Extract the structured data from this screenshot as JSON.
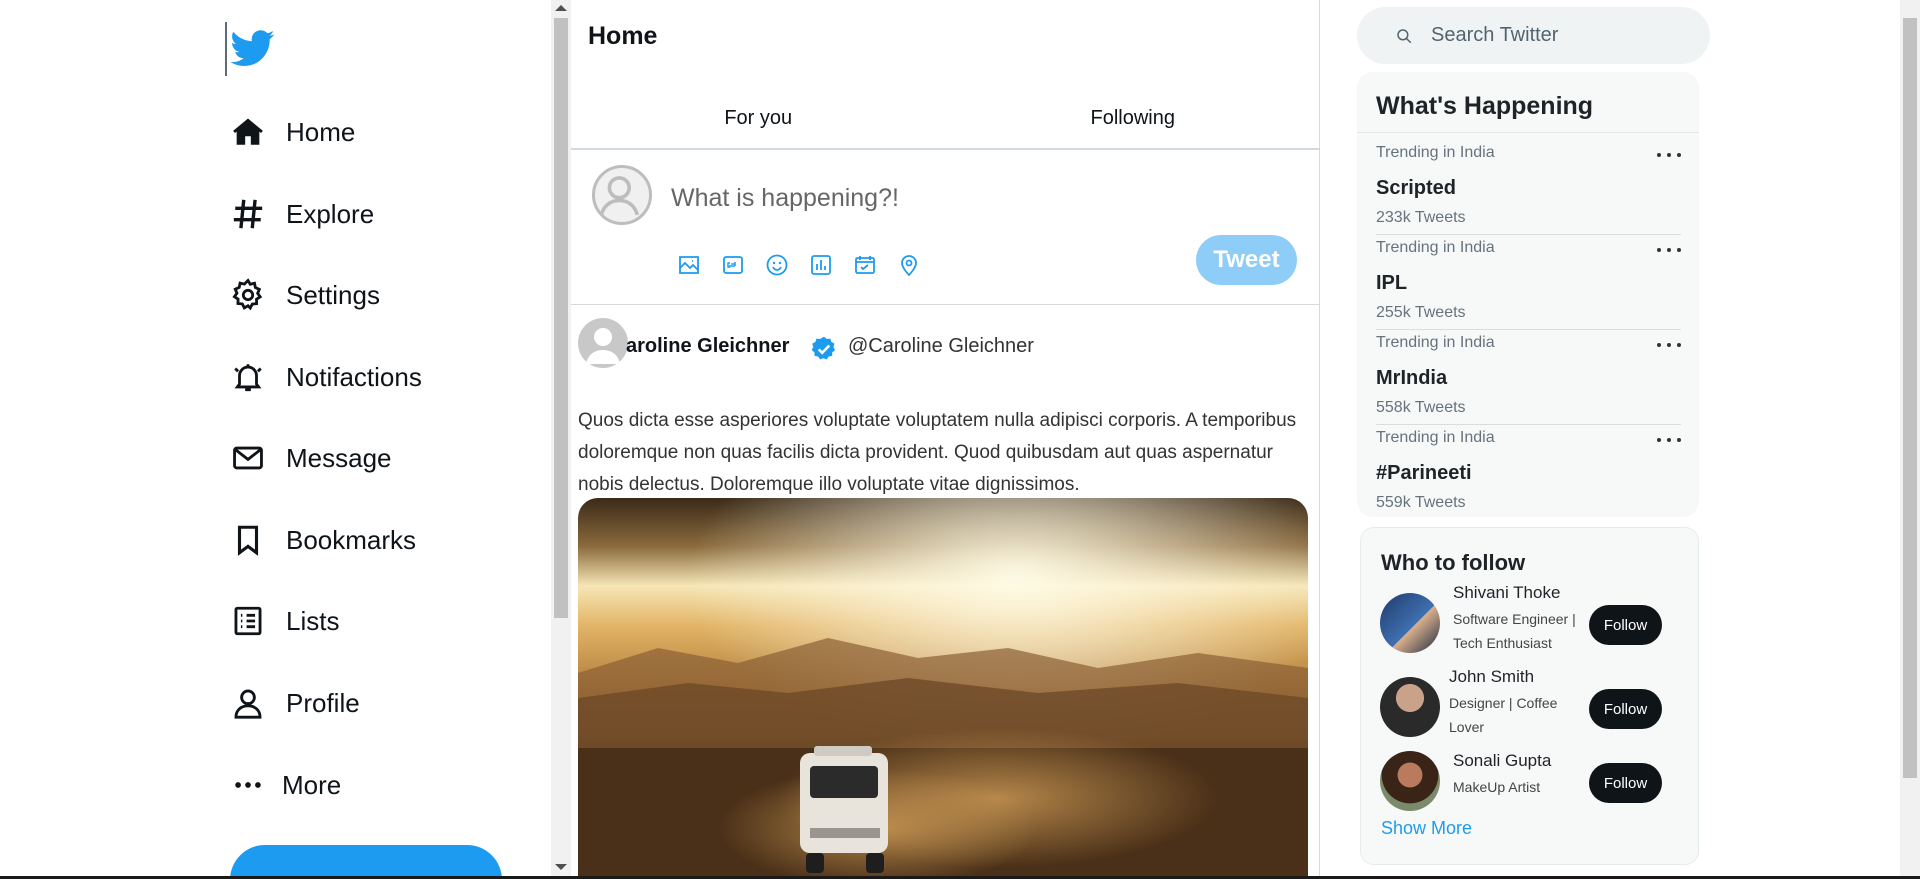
{
  "brand": {
    "logo_icon": "twitter-bird-icon",
    "color": "#1d9bf0"
  },
  "sidebar": {
    "items": [
      {
        "label": "Home",
        "icon": "home-icon"
      },
      {
        "label": "Explore",
        "icon": "hashtag-icon"
      },
      {
        "label": "Settings",
        "icon": "gear-icon"
      },
      {
        "label": "Notifactions",
        "icon": "bell-icon"
      },
      {
        "label": "Message",
        "icon": "mail-icon"
      },
      {
        "label": "Bookmarks",
        "icon": "bookmark-icon"
      },
      {
        "label": "Lists",
        "icon": "list-icon"
      },
      {
        "label": "Profile",
        "icon": "user-icon"
      },
      {
        "label": "More",
        "icon": "more-dots-icon"
      }
    ]
  },
  "feed": {
    "title": "Home",
    "tabs": [
      {
        "label": "For you"
      },
      {
        "label": "Following"
      }
    ],
    "composer": {
      "placeholder": "What is happening?!",
      "tweet_label": "Tweet",
      "tools": [
        "image-icon",
        "gif-icon",
        "emoji-icon",
        "poll-icon",
        "schedule-icon",
        "location-icon"
      ]
    },
    "post": {
      "name": "aroline Gleichner",
      "handle": "@Caroline Gleichner",
      "text": "Quos dicta esse asperiores voluptate voluptatem nulla adipisci corporis. A temporibus doloremque non quas facilis dicta provident. Quod quibusdam aut quas aspernatur nobis delectus. Doloremque illo voluptate vitae dignissimos."
    }
  },
  "search": {
    "placeholder": "Search Twitter"
  },
  "whats_happening": {
    "title": "What's Happening",
    "trends": [
      {
        "context": "Trending in India",
        "name": "Scripted",
        "count": "233k Tweets"
      },
      {
        "context": "Trending in India",
        "name": "IPL",
        "count": "255k Tweets"
      },
      {
        "context": "Trending in India",
        "name": "MrIndia",
        "count": "558k Tweets"
      },
      {
        "context": "Trending in India",
        "name": "#Parineeti",
        "count": "559k Tweets"
      }
    ]
  },
  "who_to_follow": {
    "title": "Who to follow",
    "people": [
      {
        "name": "Shivani Thoke",
        "bio": "Software Engineer | Tech Enthusiast",
        "follow_label": "Follow"
      },
      {
        "name": "John Smith",
        "bio": "Designer | Coffee Lover",
        "follow_label": "Follow"
      },
      {
        "name": "Sonali Gupta",
        "bio": "MakeUp Artist",
        "follow_label": "Follow"
      }
    ],
    "show_more": "Show More"
  }
}
